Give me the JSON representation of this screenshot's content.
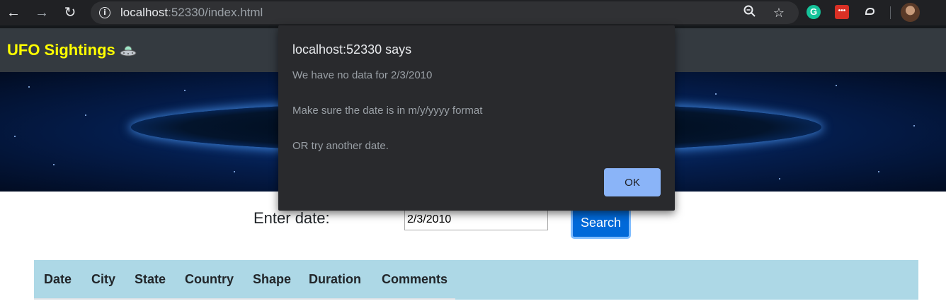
{
  "browser": {
    "url_host": "localhost",
    "url_rest": ":52330/index.html",
    "icons": [
      "back-arrow-icon",
      "forward-arrow-icon",
      "reload-icon",
      "info-icon",
      "zoom-icon",
      "star-icon",
      "grammarly-icon",
      "extension-icon",
      "extension-icon-2",
      "profile-avatar"
    ]
  },
  "navbar": {
    "brand": "UFO Sightings",
    "brand_color": "#ffff00",
    "background": "#343a40"
  },
  "form": {
    "label": "Enter date:",
    "date_value": "2/3/2010",
    "search_label": "Search"
  },
  "table": {
    "headers": [
      "Date",
      "City",
      "State",
      "Country",
      "Shape",
      "Duration",
      "Comments"
    ],
    "header_background": "#add8e6",
    "rows": []
  },
  "dialog": {
    "title": "localhost:52330 says",
    "lines": [
      "We have no data for 2/3/2010",
      "Make sure the date is in m/y/yyyy format",
      "OR try another date."
    ],
    "ok_label": "OK"
  },
  "colors": {
    "primary_button": "#0069d9",
    "dialog_bg": "#292a2d",
    "dialog_ok": "#8ab4f8"
  }
}
